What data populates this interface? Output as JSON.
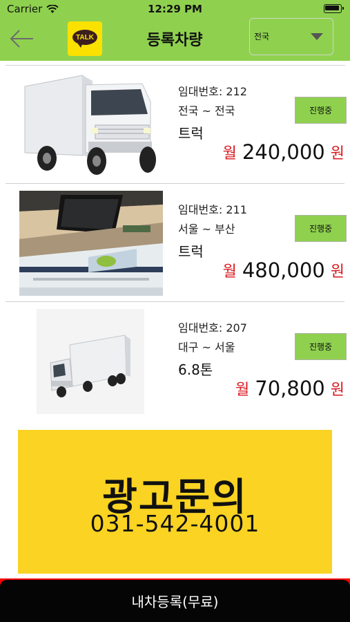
{
  "status_bar": {
    "carrier": "Carrier",
    "time": "12:29 PM"
  },
  "header": {
    "back_icon": "arrow-left-icon",
    "logo_text": "TALK",
    "title": "등록차량",
    "region_select": {
      "value": "전국"
    }
  },
  "listings": [
    {
      "id_label": "임대번호: 212",
      "route": "전국 ~ 전국",
      "type": "트럭",
      "status": "진행중",
      "price_prefix": "월",
      "price": "240,000",
      "price_suffix": "원",
      "image": "white-box-truck-front"
    },
    {
      "id_label": "임대번호: 211",
      "route": "서울 ~ 부산",
      "type": "트럭",
      "status": "진행중",
      "price_prefix": "월",
      "price": "480,000",
      "price_suffix": "원",
      "image": "truck-cargo-ceiling-photo"
    },
    {
      "id_label": "임대번호: 207",
      "route": "대구 ~ 서울",
      "type": "6.8톤",
      "status": "진행중",
      "price_prefix": "월",
      "price": "70,800",
      "price_suffix": "원",
      "image": "white-box-truck-side"
    }
  ],
  "ad": {
    "title": "광고문의",
    "phone": "031-542-4001"
  },
  "bottom": {
    "register_label": "내차등록(무료)"
  },
  "colors": {
    "header_green": "#8fd14f",
    "price_red": "#d9161c",
    "ad_yellow": "#fad323",
    "bottom_black": "#050505"
  }
}
